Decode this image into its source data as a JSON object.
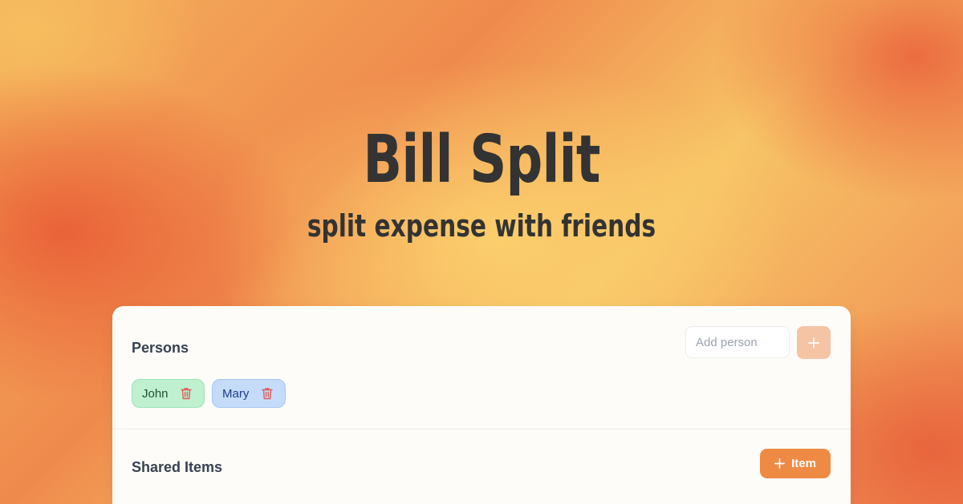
{
  "hero": {
    "title": "Bill Split",
    "subtitle": "split expense with friends"
  },
  "persons_section": {
    "title": "Persons",
    "add_person_placeholder": "Add person",
    "add_button_icon": "plus-icon",
    "people": [
      {
        "name": "John",
        "delete_icon": "trash-icon",
        "chip_color": "#bff0cf"
      },
      {
        "name": "Mary",
        "delete_icon": "trash-icon",
        "chip_color": "#c4dcf9"
      }
    ]
  },
  "shared_items_section": {
    "title": "Shared Items",
    "add_item_label": "Item",
    "add_item_icon": "plus-icon"
  },
  "colors": {
    "accent": "#ef8a44",
    "accent_light": "#f5c4a4",
    "delete_icon": "#e05a5a",
    "text": "#333333"
  }
}
